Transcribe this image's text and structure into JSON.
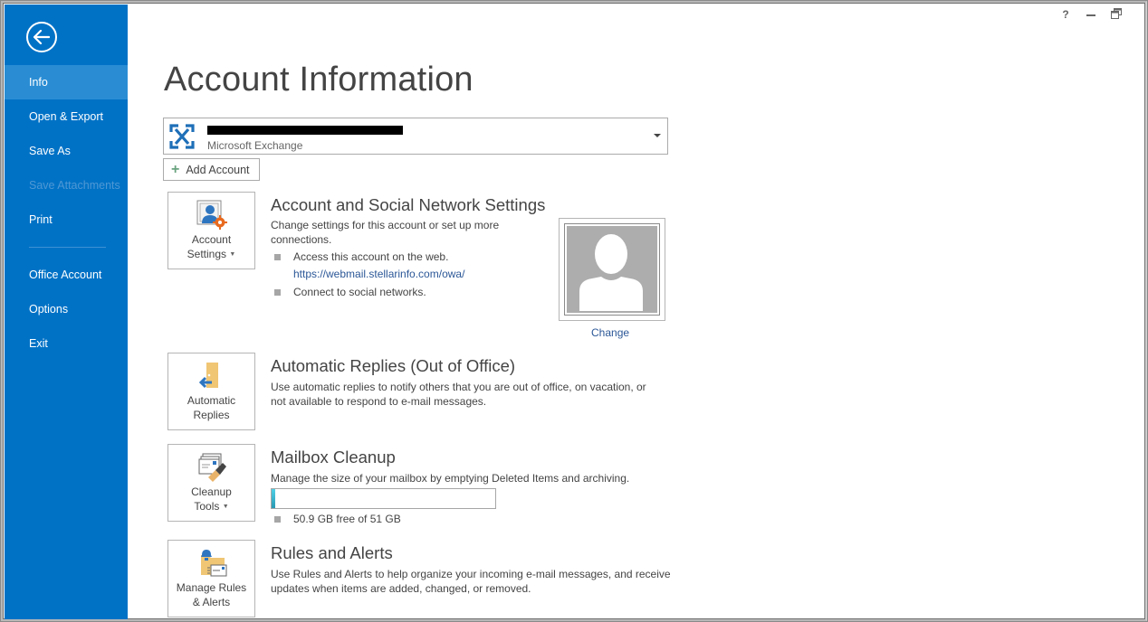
{
  "window": {
    "title_buttons": {
      "help": "?",
      "minimize": "—",
      "restore": "🗗"
    }
  },
  "sidebar": {
    "back_icon": "back-arrow-icon",
    "items": [
      {
        "label": "Info",
        "state": "active"
      },
      {
        "label": "Open & Export",
        "state": "normal"
      },
      {
        "label": "Save As",
        "state": "normal"
      },
      {
        "label": "Save Attachments",
        "state": "disabled"
      },
      {
        "label": "Print",
        "state": "normal"
      },
      {
        "label": "Office Account",
        "state": "normal"
      },
      {
        "label": "Options",
        "state": "normal"
      },
      {
        "label": "Exit",
        "state": "normal"
      }
    ]
  },
  "main": {
    "title": "Account Information",
    "account_selector": {
      "account_name": "[redacted]",
      "account_type": "Microsoft Exchange",
      "icon": "exchange-icon"
    },
    "add_account_label": "Add Account",
    "sections": {
      "account_settings": {
        "tile_label_line1": "Account",
        "tile_label_line2": "Settings",
        "title": "Account and Social Network Settings",
        "desc_line1": "Change settings for this account or set up more",
        "desc_line2": "connections.",
        "bullet1": "Access this account on the web.",
        "link": "https://webmail.stellarinfo.com/owa/",
        "bullet2": "Connect to social networks.",
        "profile_change_label": "Change"
      },
      "automatic_replies": {
        "tile_label_line1": "Automatic",
        "tile_label_line2": "Replies",
        "title": "Automatic Replies (Out of Office)",
        "desc_line1": "Use automatic replies to notify others that you are out of office, on vacation, or",
        "desc_line2": "not available to respond to e-mail messages."
      },
      "mailbox_cleanup": {
        "tile_label_line1": "Cleanup",
        "tile_label_line2": "Tools",
        "title": "Mailbox Cleanup",
        "desc": "Manage the size of your mailbox by emptying Deleted Items and archiving.",
        "quota_used_fraction": 0.002,
        "quota_text": "50.9 GB free of 51 GB",
        "quota_color": "#2fb3d0"
      },
      "rules_alerts": {
        "tile_label_line1": "Manage Rules",
        "tile_label_line2": "& Alerts",
        "title": "Rules and Alerts",
        "desc_line1": "Use Rules and Alerts to help organize your incoming e-mail messages, and receive",
        "desc_line2": "updates when items are added, changed, or removed."
      }
    }
  },
  "colors": {
    "sidebar_bg": "#0072c6",
    "sidebar_active": "#2a8dd4",
    "link": "#2b5797"
  }
}
